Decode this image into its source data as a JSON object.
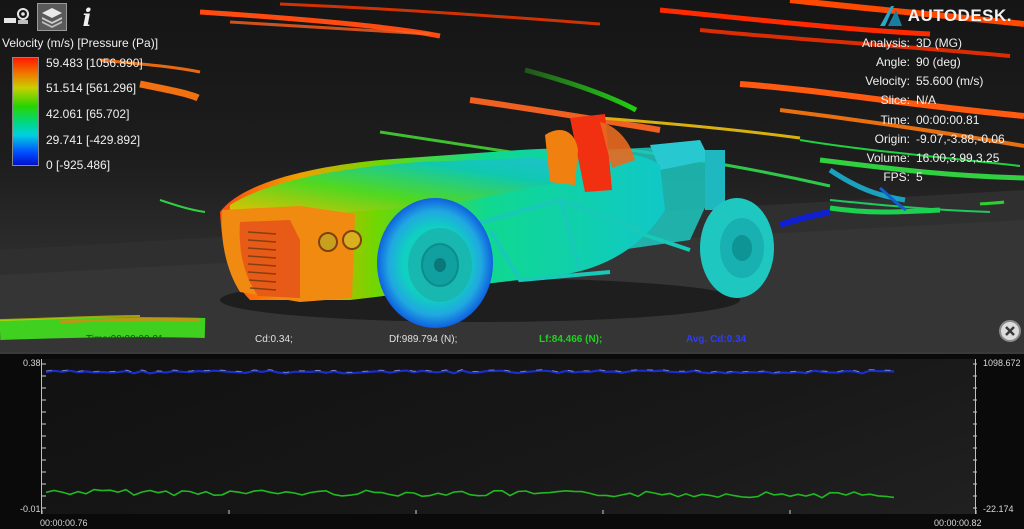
{
  "toolbar": {
    "buttons": [
      {
        "icon": "tools-icon"
      },
      {
        "icon": "layers-icon"
      },
      {
        "icon": "info-icon"
      }
    ],
    "brand": "AUTODESK."
  },
  "legend": {
    "title": "Velocity (m/s) [Pressure (Pa)]",
    "labels": [
      "59.483 [1056.890]",
      "51.514 [561.296]",
      "42.061 [65.702]",
      "29.741 [-429.892]",
      "0 [-925.486]"
    ]
  },
  "info": [
    {
      "key": "Analysis:",
      "value": "3D (MG)"
    },
    {
      "key": "Angle:",
      "value": "90 (deg)"
    },
    {
      "key": "Velocity:",
      "value": "55.600 (m/s)"
    },
    {
      "key": "Slice:",
      "value": "N/A"
    },
    {
      "key": "Time:",
      "value": "00:00:00.81"
    },
    {
      "key": "Origin:",
      "value": "-9.07,-3.88,-0.06"
    },
    {
      "key": "Volume:",
      "value": "16.00,3.99,3.25"
    },
    {
      "key": "FPS:",
      "value": "5"
    }
  ],
  "status": {
    "time": "Time:00:00:00.81",
    "cd": "Cd:0.34;",
    "df": "Df:989.794 (N);",
    "lf": "Lf:84.466 (N);",
    "avg_cd": "Avg. Cd:0.34"
  },
  "colors": {
    "lf": "#1fd11f",
    "avg_cd": "#2a3cff",
    "series_top": "#1a2ecc",
    "series_bottom": "#22b822"
  },
  "graph": {
    "y_left_max": "0.38",
    "y_left_min": "-0.01",
    "y_right_max": "1098.672",
    "y_right_min": "-22.174",
    "x_start": "00:00:00.76",
    "x_end": "00:00:00.82"
  }
}
